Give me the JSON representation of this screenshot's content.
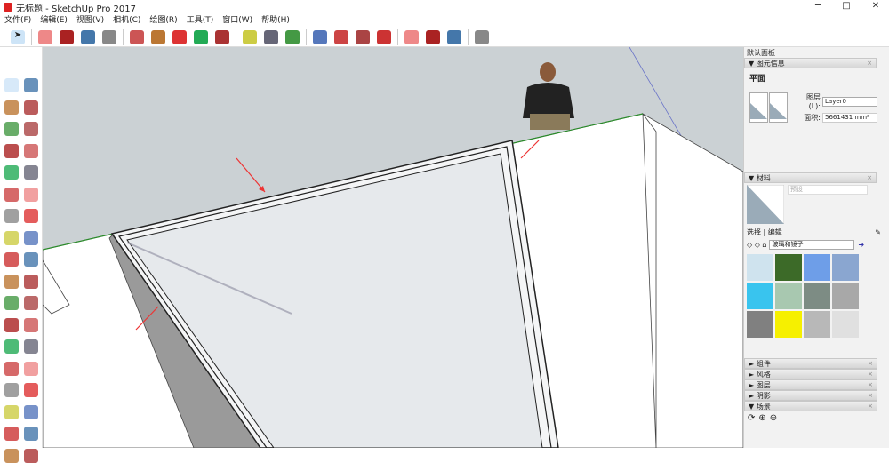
{
  "window": {
    "title": "无标题 - SketchUp Pro 2017",
    "minimize": "─",
    "maximize": "□",
    "close": "✕"
  },
  "menu": [
    "文件(F)",
    "编辑(E)",
    "视图(V)",
    "相机(C)",
    "绘图(R)",
    "工具(T)",
    "窗口(W)",
    "帮助(H)"
  ],
  "toolbar_icons": [
    "select",
    "eraser",
    "pencil",
    "arc",
    "rectangle",
    "push-pull",
    "follow-me",
    "move",
    "rotate",
    "scale",
    "tape-measure",
    "text",
    "paint-bucket",
    "orbit",
    "pan",
    "zoom",
    "zoom-extents",
    "warehouse",
    "extension-warehouse",
    "send-to-layout",
    "extension-manager"
  ],
  "left_tools": [
    "select",
    "make-component",
    "paint-bucket",
    "eraser",
    "pencil",
    "freehand",
    "rectangle",
    "rotated-rectangle",
    "circle",
    "polygon",
    "arc",
    "arc-2pt",
    "arc-3pt",
    "pie",
    "move",
    "push-pull",
    "rotate",
    "follow-me",
    "scale",
    "offset",
    "tape-measure",
    "dimension",
    "protractor",
    "text",
    "axes",
    "3d-text",
    "orbit",
    "pan",
    "zoom",
    "zoom-window",
    "zoom-extents",
    "previous",
    "position-camera",
    "look-around",
    "walk",
    "section-plane"
  ],
  "panel": {
    "title": "默认面板",
    "entity_info": {
      "header": "图元信息",
      "type": "平面",
      "layer_label": "图层(L):",
      "layer_value": "Layer0",
      "area_label": "面积:",
      "area_value": "5661431 mm²"
    },
    "materials": {
      "header": "材料",
      "name_placeholder": "预设",
      "tab_select": "选择",
      "tab_edit": "编辑",
      "library": "玻璃和镜子",
      "swatches": [
        "#cfe3ee",
        "#3c6a28",
        "#6e9ee8",
        "#8aa6d0",
        "#39c4ee",
        "#a8c8b0",
        "#7d8c84",
        "#a8a8a8",
        "#808080",
        "#f6f000",
        "#b8b8b8",
        "#e0e0e0"
      ]
    },
    "collapsed": [
      "组件",
      "风格",
      "图层",
      "阴影"
    ],
    "scenes": {
      "header": "场景"
    }
  },
  "colors": {
    "sky": "#cbd1d4",
    "accent": "#d22"
  }
}
